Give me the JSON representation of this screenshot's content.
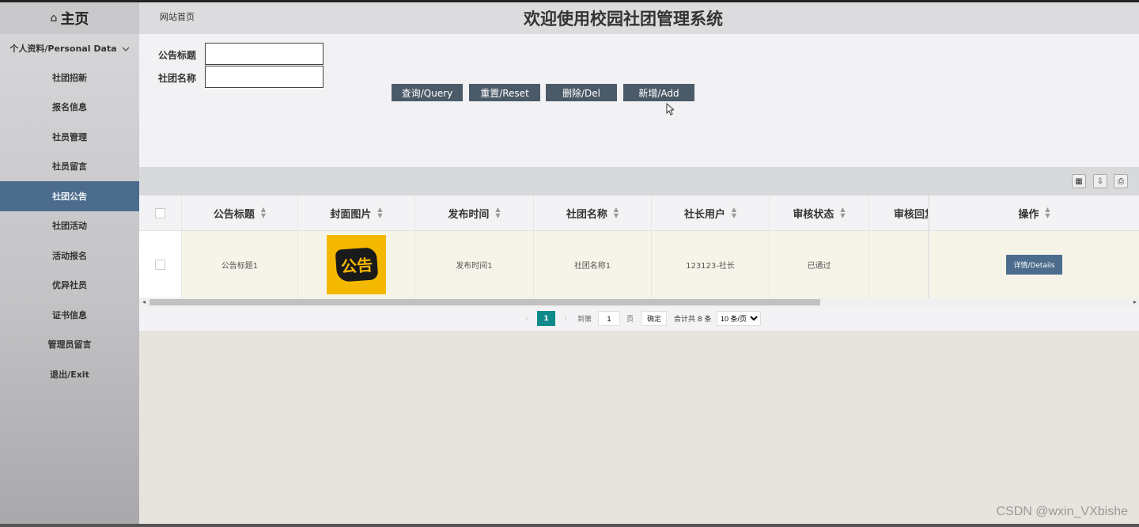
{
  "sidebar": {
    "home": "主页",
    "group": "个人资料/Personal Data",
    "items": [
      "社团招新",
      "报名信息",
      "社员管理",
      "社员留言",
      "社团公告",
      "社团活动",
      "活动报名",
      "优异社员",
      "证书信息",
      "管理员留言",
      "退出/Exit"
    ],
    "active_index": 4
  },
  "header": {
    "breadcrumb": "网站首页",
    "title": "欢迎使用校园社团管理系统"
  },
  "search": {
    "field1_label": "公告标题",
    "field1_value": "",
    "field2_label": "社团名称",
    "field2_value": "",
    "buttons": [
      "查询/Query",
      "重置/Reset",
      "删除/Del",
      "新增/Add"
    ]
  },
  "table": {
    "columns": [
      "公告标题",
      "封面图片",
      "发布时间",
      "社团名称",
      "社长用户",
      "审核状态",
      "审核回复",
      "操作"
    ],
    "rows": [
      {
        "title": "公告标题1",
        "cover_text": "公告",
        "time": "发布时间1",
        "club": "社团名称1",
        "leader": "123123-社长",
        "status": "已通过",
        "reply": "",
        "action": "详情/Details"
      }
    ]
  },
  "pagination": {
    "current": "1",
    "goto_label": "到第",
    "goto_value": "1",
    "page_suffix": "页",
    "confirm": "确定",
    "total": "合计共 8 条",
    "page_size": "10 条/页"
  },
  "watermark": "CSDN @wxin_VXbishe"
}
